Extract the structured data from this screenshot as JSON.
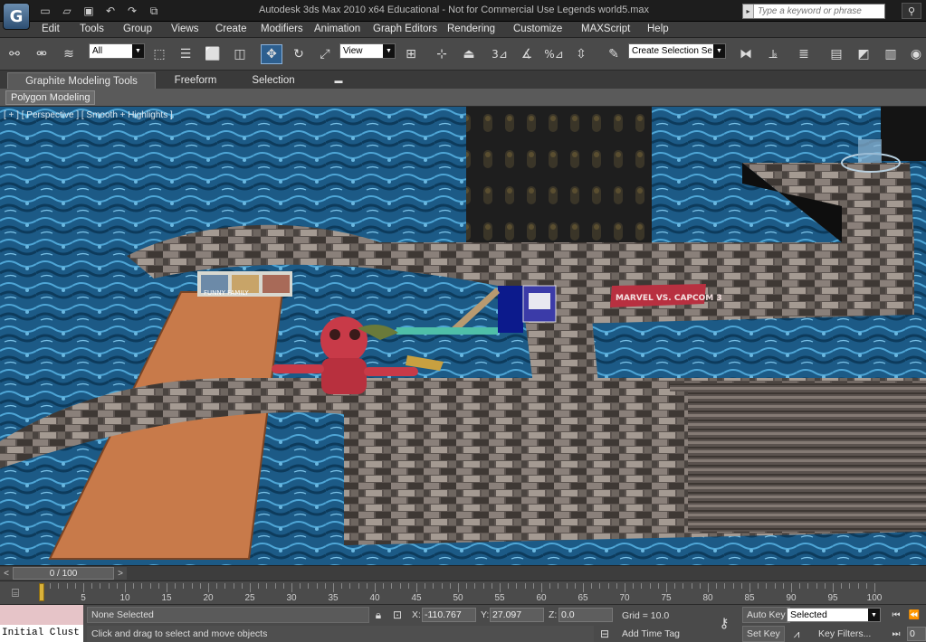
{
  "app": {
    "logo_glyph": "G",
    "title": "Autodesk 3ds Max  2010 x64   Educational - Not for Commercial Use    Legends world5.max"
  },
  "quick_access": [
    "new-icon",
    "open-icon",
    "save-icon",
    "undo-icon",
    "redo-icon",
    "project-icon"
  ],
  "search": {
    "placeholder": "Type a keyword or phrase"
  },
  "menu": [
    "Edit",
    "Tools",
    "Group",
    "Views",
    "Create",
    "Modifiers",
    "Animation",
    "Graph Editors",
    "Rendering",
    "Customize",
    "MAXScript",
    "Help"
  ],
  "toolbar": {
    "filter_value": "All",
    "refcoord_value": "View",
    "selection_set_value": "Create Selection Se",
    "snap_3": "3",
    "snap_percent": "%"
  },
  "ribbon": {
    "tabs": [
      "Graphite Modeling Tools",
      "Freeform",
      "Selection"
    ],
    "panel_button": "Polygon Modeling"
  },
  "viewport": {
    "label": "[ + ] [ Perspective ] [ Smooth + Highlights ]",
    "banner_left": "FUNNY FAMILY",
    "banner_right": "MARVEL VS. CAPCOM 3"
  },
  "timeline": {
    "frame_display": "0 / 100",
    "ticks": [
      0,
      5,
      10,
      15,
      20,
      25,
      30,
      35,
      40,
      45,
      50,
      55,
      60,
      65,
      70,
      75,
      80,
      85,
      90,
      95,
      100
    ],
    "current_frame": 0
  },
  "status": {
    "listener_output": "Initial Clust",
    "selection_info": "None Selected",
    "prompt": "Click and drag to select and move objects",
    "x_label": "X:",
    "x_value": "-110.767",
    "y_label": "Y:",
    "y_value": "27.097",
    "z_label": "Z:",
    "z_value": "0.0",
    "grid": "Grid = 10.0",
    "add_time_tag": "Add Time Tag",
    "auto_key": "Auto Key",
    "key_mode": "Selected",
    "set_key": "Set Key",
    "key_filters": "Key Filters...",
    "frame_field": "0"
  },
  "colors": {
    "water": "#1d5a85",
    "wood_plank": "#c87a4a",
    "selection_highlight": "#2d5f8f"
  }
}
